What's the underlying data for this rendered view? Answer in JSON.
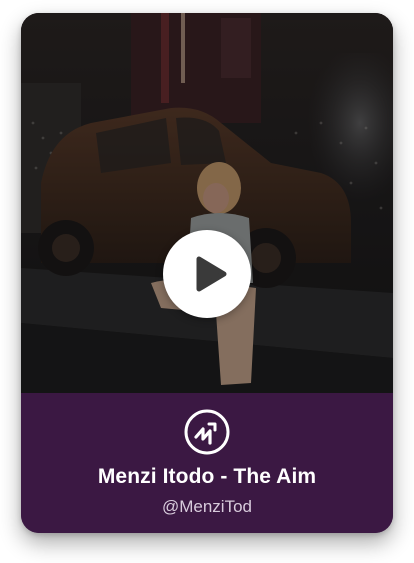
{
  "card": {
    "title": "Menzi Itodo - The Aim",
    "handle": "@MenziTod"
  },
  "media": {
    "description_icon": "photo-thumbnail",
    "play_icon": "play-icon"
  },
  "brand": {
    "icon": "audiomack-logo-icon",
    "accent": "#3b1843",
    "text_color": "#ffffff",
    "subtext_color": "#d8cbdc"
  }
}
